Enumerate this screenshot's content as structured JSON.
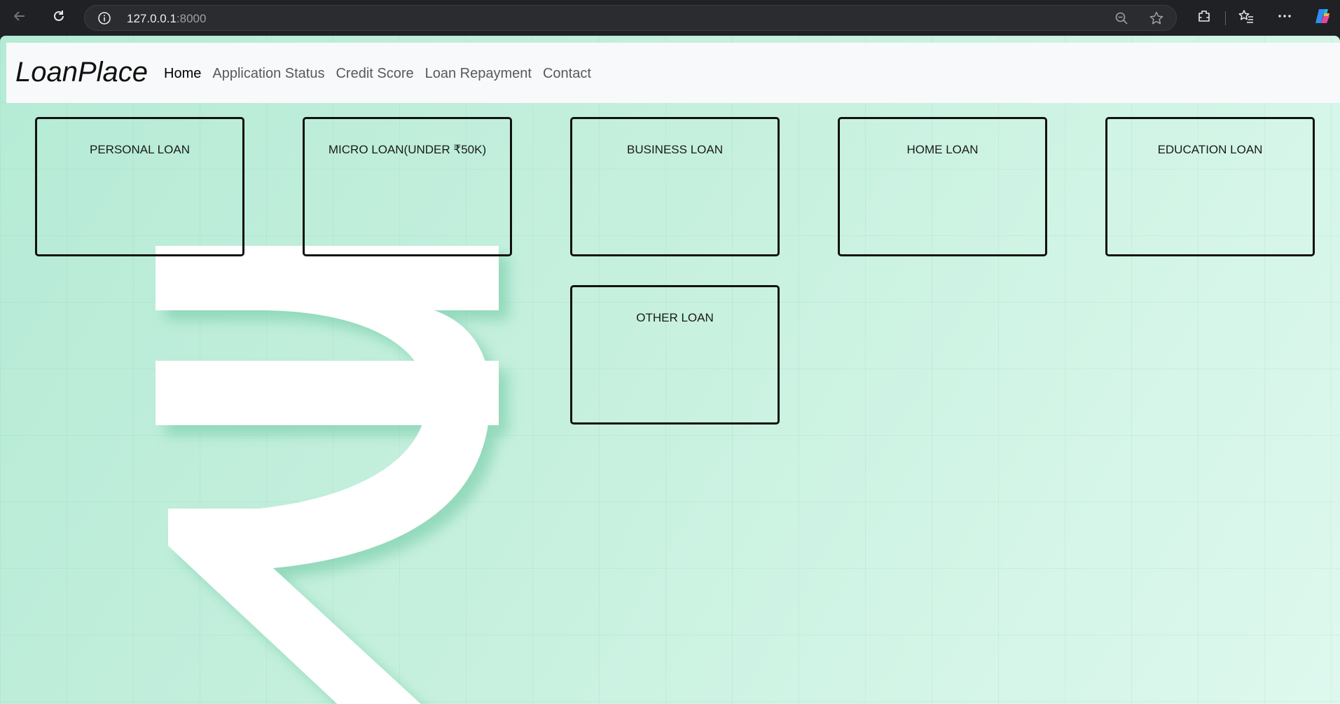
{
  "browser": {
    "url_host": "127.0.0.1",
    "url_port": ":8000",
    "icons": {
      "back": "back-arrow-icon",
      "reload": "reload-icon",
      "info": "site-info-icon",
      "zoom": "zoom-out-icon",
      "favorite": "favorite-star-icon",
      "extensions": "extensions-icon",
      "favorites": "favorites-icon",
      "menu": "more-options-icon",
      "copilot": "copilot-icon"
    }
  },
  "navbar": {
    "brand": "LoanPlace",
    "links": [
      {
        "label": "Home",
        "active": true
      },
      {
        "label": "Application Status",
        "active": false
      },
      {
        "label": "Credit Score",
        "active": false
      },
      {
        "label": "Loan Repayment",
        "active": false
      },
      {
        "label": "Contact",
        "active": false
      }
    ]
  },
  "loans": [
    {
      "title": "PERSONAL LOAN"
    },
    {
      "title": "MICRO LOAN(UNDER ₹50K)"
    },
    {
      "title": "BUSINESS LOAN"
    },
    {
      "title": "HOME LOAN"
    },
    {
      "title": "EDUCATION LOAN"
    },
    {
      "title": "OTHER LOAN"
    }
  ],
  "colors": {
    "background": "#c6f0de",
    "navbar": "#f8f9fa",
    "card_border": "#111111",
    "rupee": "#ffffff"
  },
  "background_art": "rupee-symbol"
}
